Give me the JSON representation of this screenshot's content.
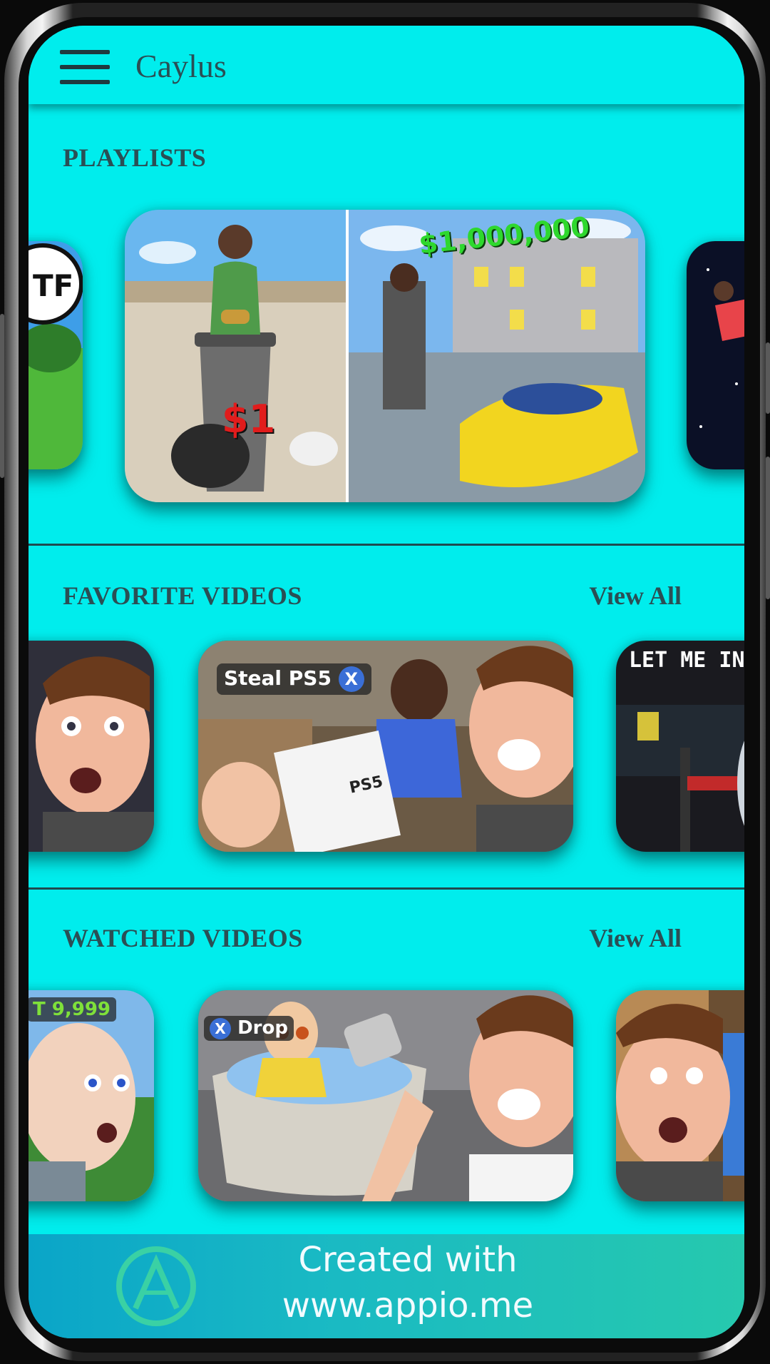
{
  "app": {
    "title": "Caylus"
  },
  "sections": {
    "playlists": {
      "title": "PLAYLISTS"
    },
    "favorites": {
      "title": "FAVORITE VIDEOS",
      "view_all": "View All"
    },
    "watched": {
      "title": "WATCHED VIDEOS",
      "view_all": "View All"
    }
  },
  "thumbnails": {
    "playlist_left": "TF",
    "playlist_main_price": "$1",
    "playlist_main_amount": "$1,000,000",
    "favorite_main": "Steal PS5",
    "favorite_main_button": "X",
    "favorite_right": "LET ME IN",
    "watched_left": "T 9,999",
    "watched_main": "Drop",
    "watched_main_button": "X",
    "ps5_box": "PS5"
  },
  "banner": {
    "line1": "Created with",
    "line2": "www.appio.me"
  },
  "icons": {
    "menu": "hamburger-menu-icon",
    "banner_logo": "appio-logo-icon"
  },
  "colors": {
    "background": "#00eded",
    "text": "#2a4f55",
    "divider": "#1f4a4f"
  }
}
